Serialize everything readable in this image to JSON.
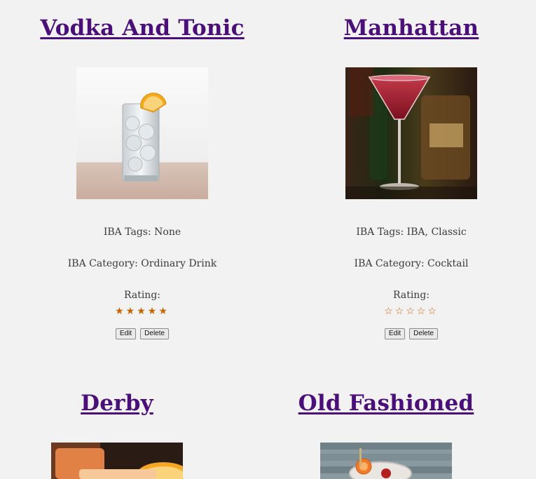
{
  "drinks": [
    {
      "name": "Vodka And Tonic",
      "iba_tags": "IBA Tags: None",
      "iba_category": "IBA Category: Ordinary Drink",
      "rating_label": "Rating:",
      "rating": 5,
      "rating_max": 5,
      "edit_label": "Edit",
      "delete_label": "Delete"
    },
    {
      "name": "Manhattan",
      "iba_tags": "IBA Tags: IBA, Classic",
      "iba_category": "IBA Category: Cocktail",
      "rating_label": "Rating:",
      "rating": 0,
      "rating_max": 5,
      "edit_label": "Edit",
      "delete_label": "Delete"
    },
    {
      "name": "Derby"
    },
    {
      "name": "Old Fashioned"
    }
  ],
  "colors": {
    "title": "#4b0f7a",
    "star": "#c86400",
    "background": "#f2f2f2"
  }
}
